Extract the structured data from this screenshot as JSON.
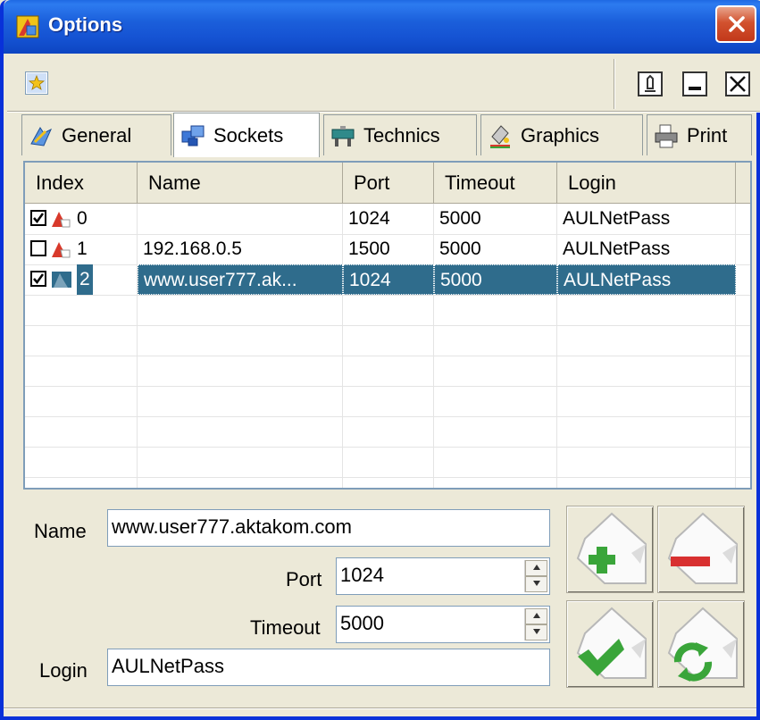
{
  "window": {
    "title": "Options"
  },
  "tabs": [
    {
      "label": "General"
    },
    {
      "label": "Sockets"
    },
    {
      "label": "Technics"
    },
    {
      "label": "Graphics"
    },
    {
      "label": "Print"
    }
  ],
  "grid": {
    "columns": [
      "Index",
      "Name",
      "Port",
      "Timeout",
      "Login"
    ],
    "rows": [
      {
        "checked": true,
        "index": "0",
        "name": "",
        "port": "1024",
        "timeout": "5000",
        "login": "AULNetPass"
      },
      {
        "checked": false,
        "index": "1",
        "name": "192.168.0.5",
        "port": "1500",
        "timeout": "5000",
        "login": "AULNetPass"
      },
      {
        "checked": true,
        "index": "2",
        "name": "www.user777.ak...",
        "port": "1024",
        "timeout": "5000",
        "login": "AULNetPass",
        "selected": true
      }
    ]
  },
  "form": {
    "name_label": "Name",
    "name_value": "www.user777.aktakom.com",
    "port_label": "Port",
    "port_value": "1024",
    "timeout_label": "Timeout",
    "timeout_value": "5000",
    "login_label": "Login",
    "login_value": "AULNetPass"
  },
  "colors": {
    "titlebar": "#1553d3",
    "selection": "#2f6c8c",
    "add": "#3aa53a",
    "remove": "#d83030"
  },
  "icons": {
    "title": "options-app-icon",
    "toolbar": [
      "star-icon",
      "pin-icon",
      "minimize-icon",
      "close-icon"
    ],
    "actions": [
      "add-icon",
      "remove-icon",
      "apply-icon",
      "refresh-icon"
    ]
  }
}
